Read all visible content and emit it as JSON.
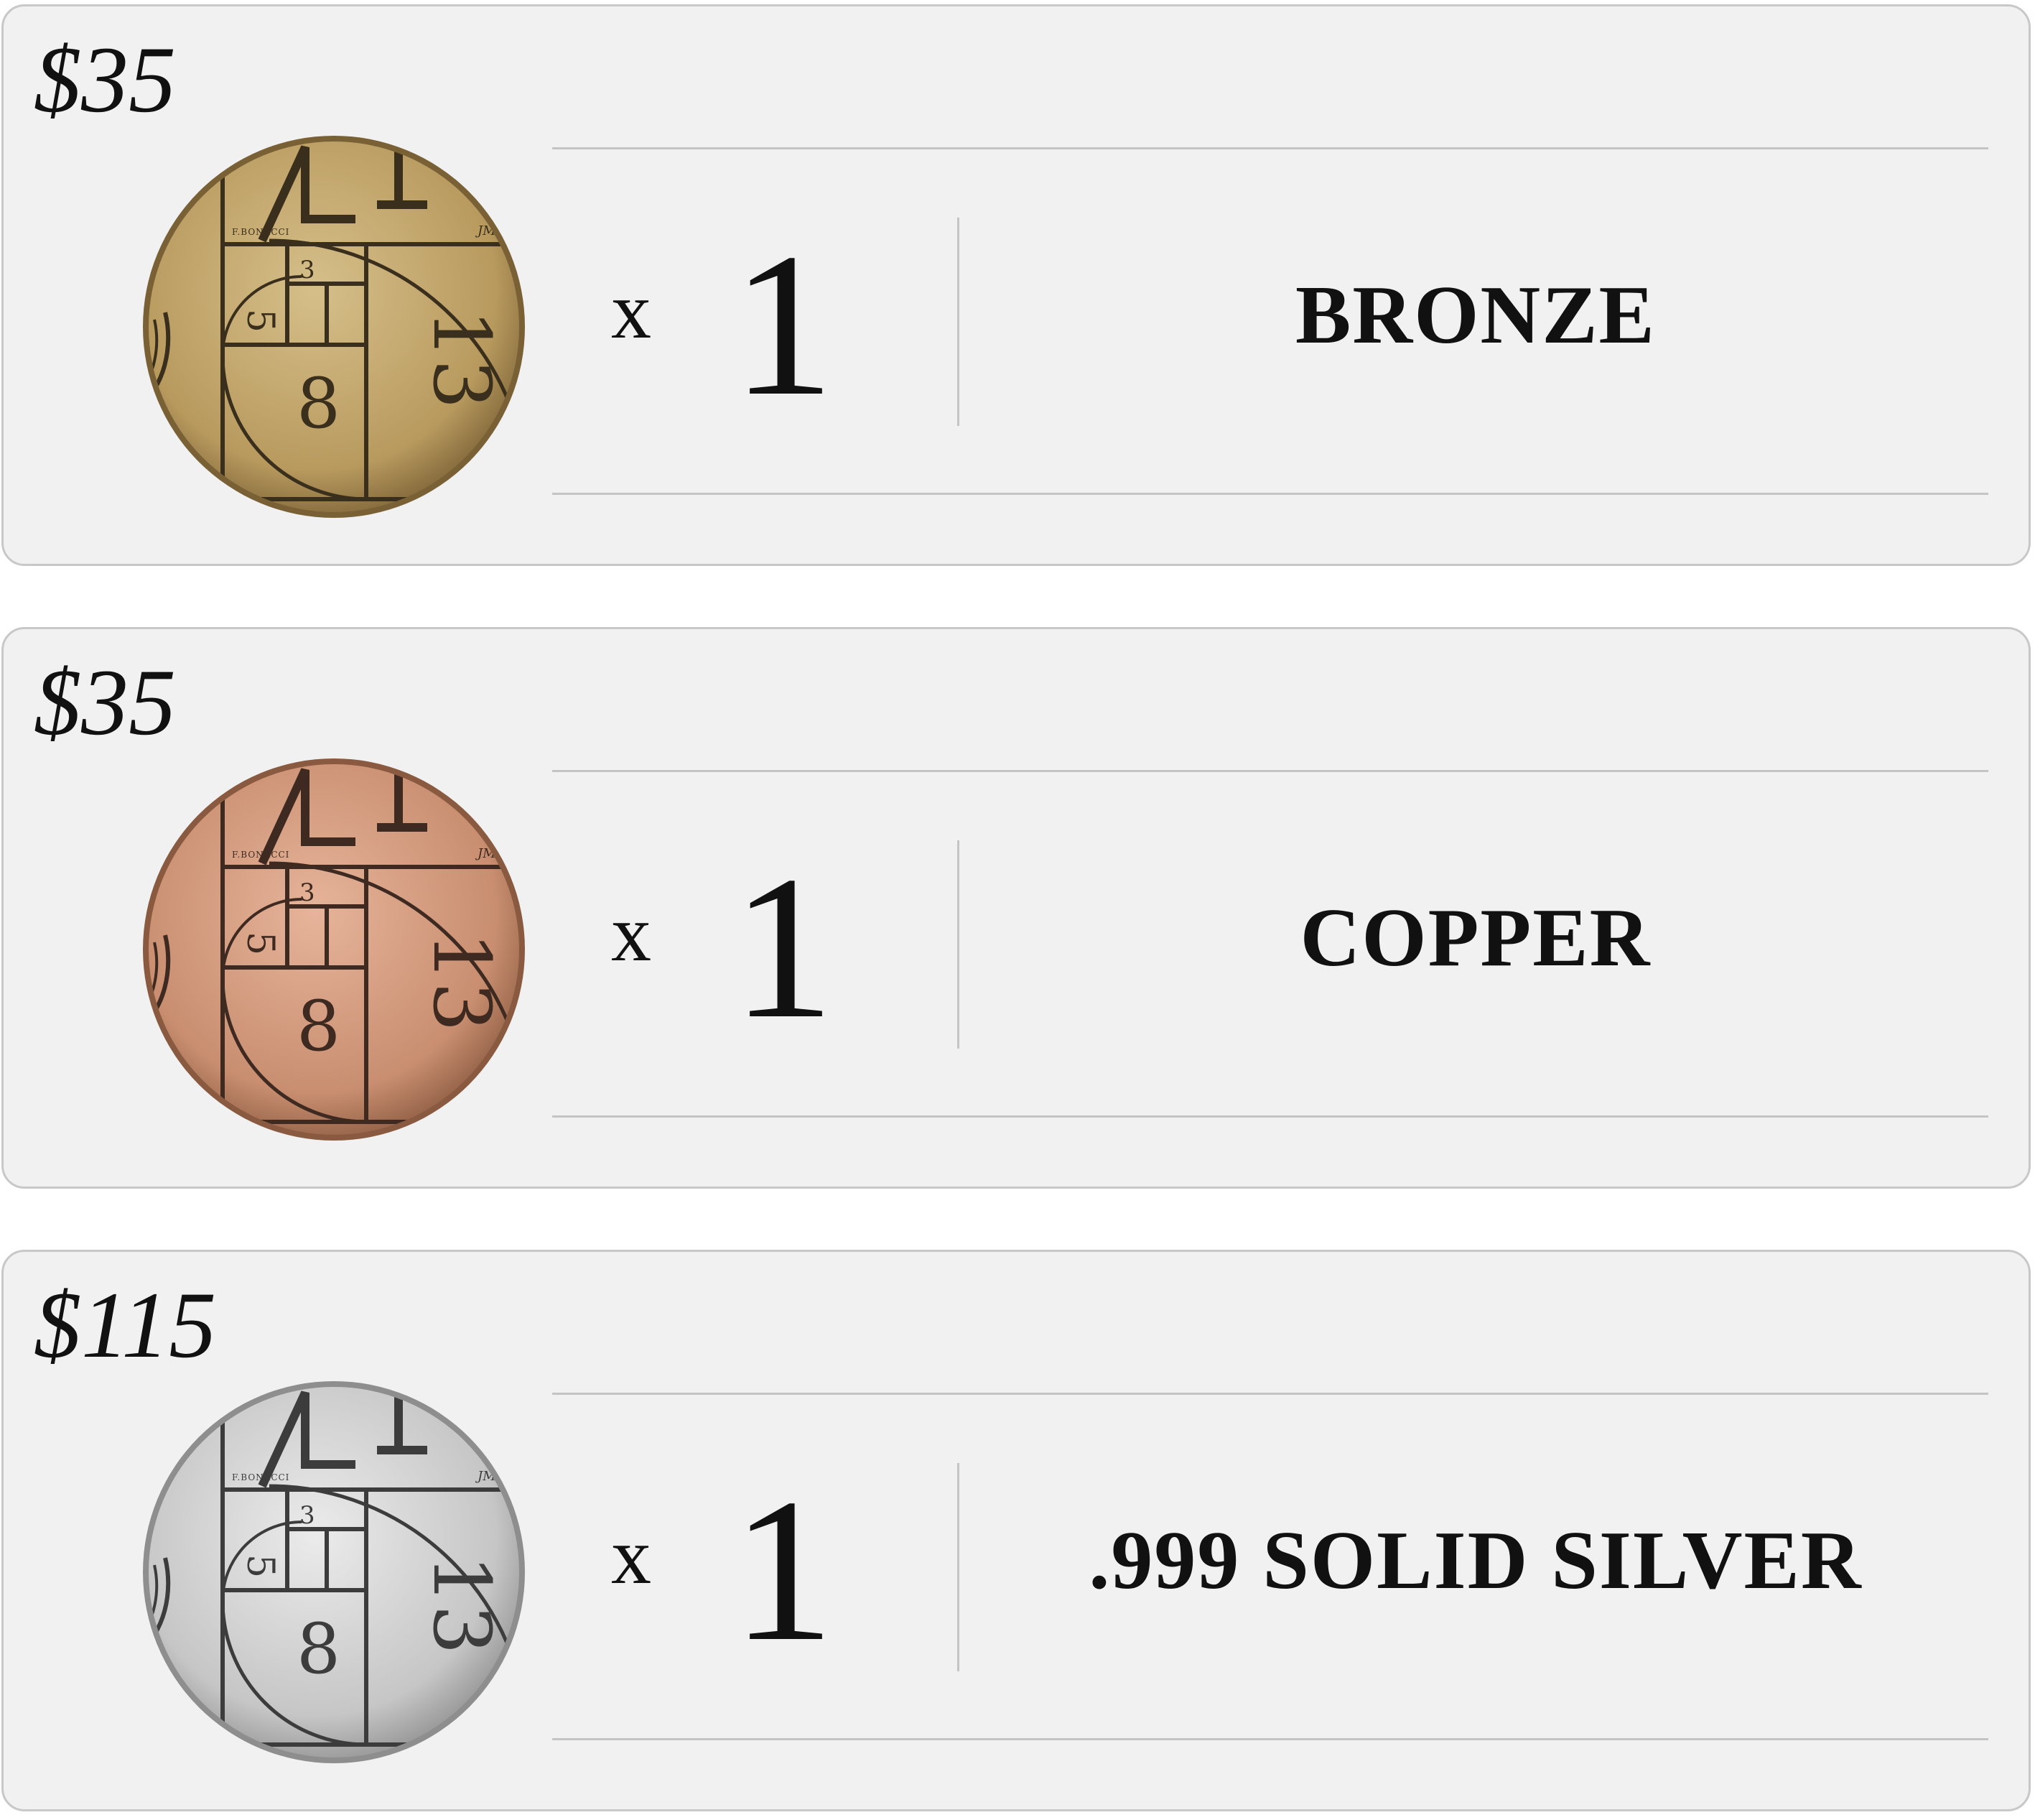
{
  "products": [
    {
      "price": "$35",
      "quantity_prefix": "x",
      "quantity": "1",
      "metal": "BRONZE",
      "coin_icon": "bronze-fibonacci-coin-icon",
      "coin_colors": {
        "light": "#d6bf8a",
        "mid": "#b89a5e",
        "dark": "#7a6035",
        "ink": "#3a2e1c"
      }
    },
    {
      "price": "$35",
      "quantity_prefix": "x",
      "quantity": "1",
      "metal": "COPPER",
      "coin_icon": "copper-fibonacci-coin-icon",
      "coin_colors": {
        "light": "#e6b49a",
        "mid": "#c98e70",
        "dark": "#8a5a40",
        "ink": "#3e2a20"
      }
    },
    {
      "price": "$115",
      "quantity_prefix": "x",
      "quantity": "1",
      "metal": ".999 SOLID SILVER",
      "coin_icon": "silver-fibonacci-coin-icon",
      "coin_colors": {
        "light": "#ebebeb",
        "mid": "#c6c6c6",
        "dark": "#8e8e8e",
        "ink": "#3c3c3c"
      }
    }
  ]
}
